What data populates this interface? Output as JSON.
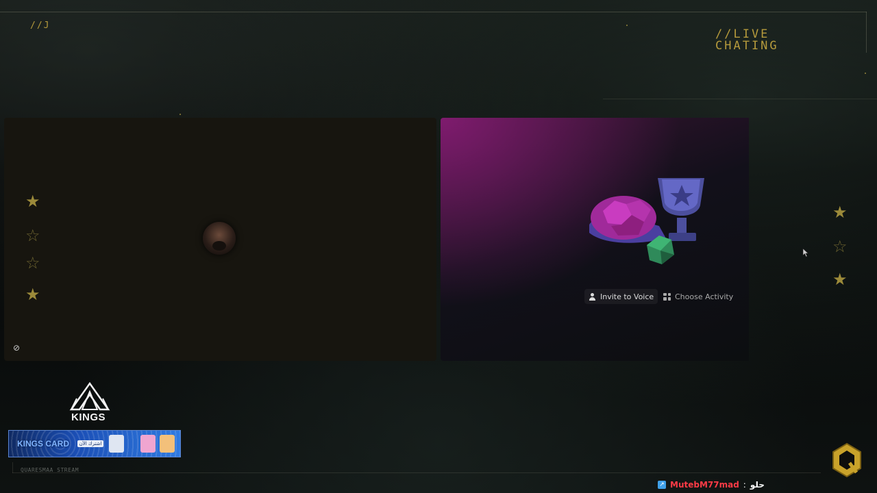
{
  "overlay": {
    "corner_tag": "//J",
    "title_line1": "//LIVE",
    "title_line2": "CHATING",
    "stream_label": "QUARESMAA STREAM"
  },
  "voice_panel": {
    "invite_label": "Invite to Voice",
    "activity_label": "Choose Activity"
  },
  "branding": {
    "logo_text": "KINGS",
    "banner_label": "KINGS CARD",
    "banner_chip": "اشترك الآن"
  },
  "chat": {
    "username": "MutebM77mad",
    "separator": ":",
    "message": "حلو"
  },
  "colors": {
    "accent_gold": "#b59a3c",
    "chat_user": "#ff3b46",
    "activity_purple": "#8e1f7f"
  }
}
